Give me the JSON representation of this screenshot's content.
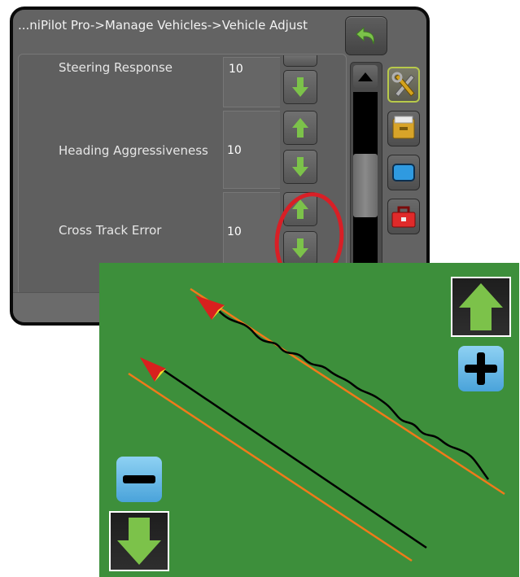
{
  "header": {
    "breadcrumb": "...niPilot Pro->Manage Vehicles->Vehicle Adjust"
  },
  "settings": [
    {
      "label": "Steering Response",
      "value": "10"
    },
    {
      "label": "Heading Aggressiveness",
      "value": "10"
    },
    {
      "label": "Cross Track Error",
      "value": "10"
    }
  ],
  "icons": {
    "back": "back-arrow-icon",
    "increase": "green-up-arrow-icon",
    "decrease": "green-down-arrow-icon",
    "plus": "plus-icon",
    "minus": "minus-icon",
    "tabs": [
      "tools-icon",
      "file-cabinet-icon",
      "display-icon",
      "toolbox-icon"
    ]
  },
  "colors": {
    "field_green": "#3d8f3b",
    "guidance_line": "#f07a1a",
    "vehicle_path": "#000000",
    "highlight_ring": "#d81f26",
    "arrow_green": "#7cc24a",
    "sign_button_blue": "#5bb3e3"
  }
}
